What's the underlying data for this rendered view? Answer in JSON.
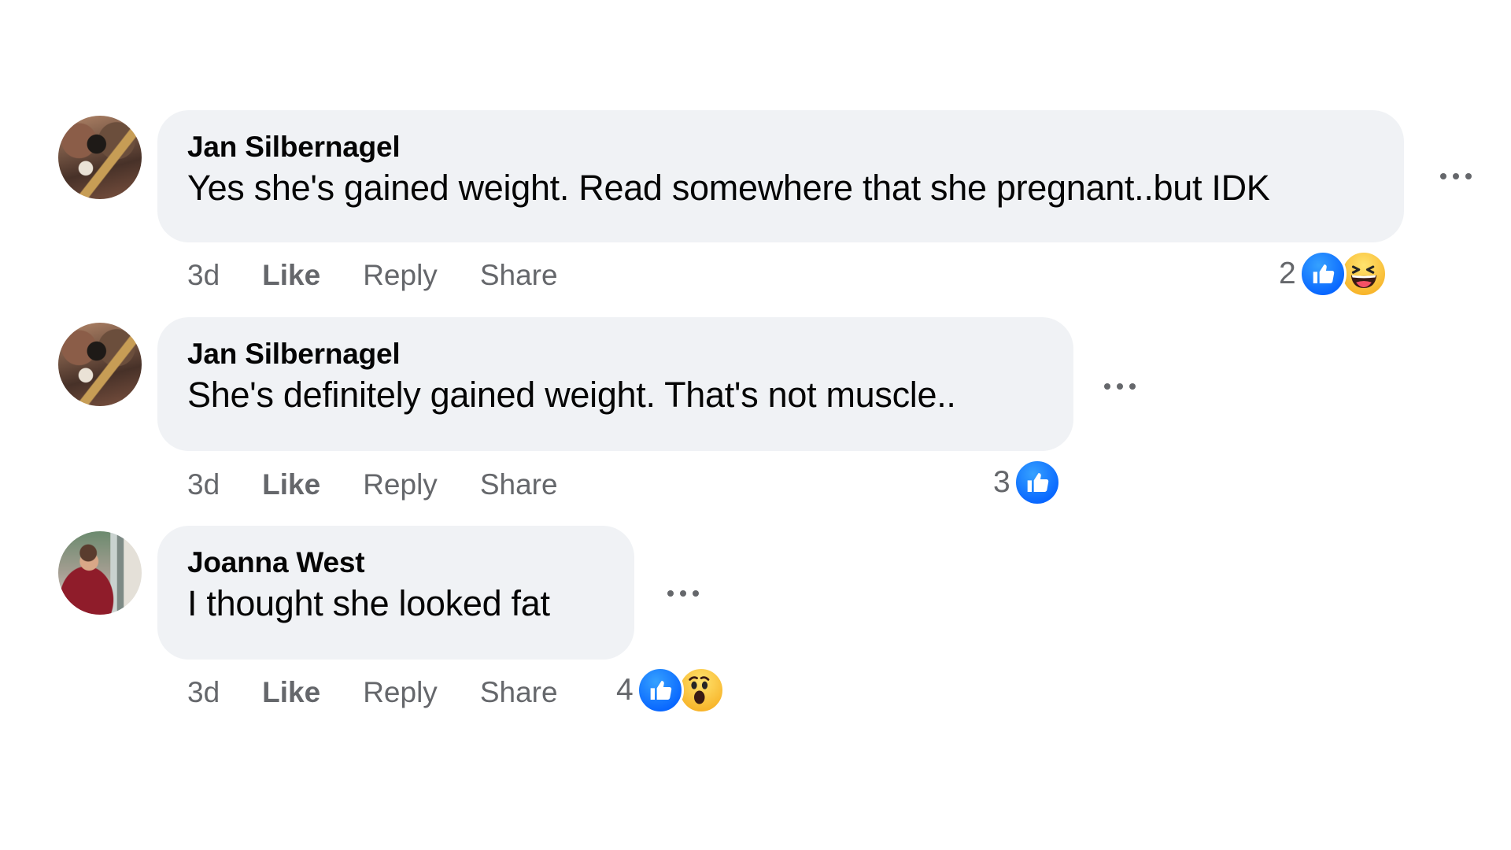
{
  "comments": [
    {
      "author": "Jan Silbernagel",
      "text": "Yes she's gained weight. Read somewhere that she pregnant..but IDK",
      "time": "3d",
      "like_label": "Like",
      "reply_label": "Reply",
      "share_label": "Share",
      "reaction_count": "2",
      "reactions": [
        "like-icon",
        "haha-icon"
      ]
    },
    {
      "author": "Jan Silbernagel",
      "text": "She's definitely gained weight. That's not muscle..",
      "time": "3d",
      "like_label": "Like",
      "reply_label": "Reply",
      "share_label": "Share",
      "reaction_count": "3",
      "reactions": [
        "like-icon"
      ]
    },
    {
      "author": "Joanna West",
      "text": "I thought she looked fat",
      "time": "3d",
      "like_label": "Like",
      "reply_label": "Reply",
      "share_label": "Share",
      "reaction_count": "4",
      "reactions": [
        "like-icon",
        "wow-icon"
      ]
    }
  ],
  "colors": {
    "bubble": "#f0f2f5",
    "secondary_text": "#65676b",
    "like_blue": "#0866ff",
    "emoji_yellow": "#f7b125"
  }
}
